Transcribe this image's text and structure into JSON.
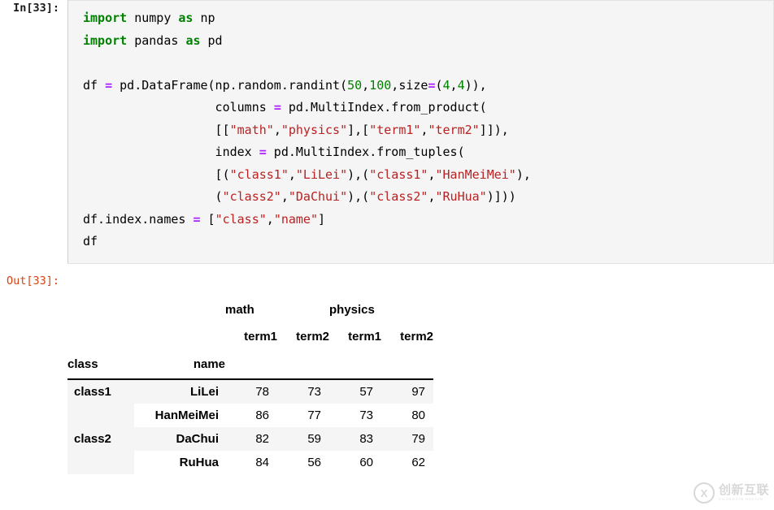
{
  "cell": {
    "input_prompt": "In[33]:",
    "output_prompt": "Out[33]:",
    "code_lines": [
      "import numpy as np",
      "import pandas as pd",
      "",
      "df = pd.DataFrame(np.random.randint(50,100,size=(4,4)),",
      "                  columns = pd.MultiIndex.from_product(",
      "                  [[\"math\",\"physics\"],[\"term1\",\"term2\"]]),",
      "                  index = pd.MultiIndex.from_tuples(",
      "                  [(\"class1\",\"LiLei\"),(\"class1\",\"HanMeiMei\"),",
      "                  (\"class2\",\"DaChui\"),(\"class2\",\"RuHua\")]))",
      "df.index.names = [\"class\",\"name\"]",
      "df"
    ]
  },
  "dataframe": {
    "column_groups": [
      "math",
      "physics"
    ],
    "column_subheaders": [
      "term1",
      "term2",
      "term1",
      "term2"
    ],
    "index_names": [
      "class",
      "name"
    ],
    "rows": [
      {
        "class": "class1",
        "name": "LiLei",
        "values": [
          78,
          73,
          57,
          97
        ]
      },
      {
        "class": "",
        "name": "HanMeiMei",
        "values": [
          86,
          77,
          73,
          80
        ]
      },
      {
        "class": "class2",
        "name": "DaChui",
        "values": [
          82,
          59,
          83,
          79
        ]
      },
      {
        "class": "",
        "name": "RuHua",
        "values": [
          84,
          56,
          60,
          62
        ]
      }
    ]
  },
  "watermark": {
    "logo_glyph": "X",
    "text_cn": "创新互联",
    "text_en": "CUANGXIN HULIAN"
  },
  "colors": {
    "keyword": "#008000",
    "string": "#ba2121",
    "number": "#008000",
    "operator": "#aa22ff",
    "out_prompt": "#d84315",
    "cell_bg": "#f5f5f5",
    "row_stripe": "#f5f5f5"
  }
}
